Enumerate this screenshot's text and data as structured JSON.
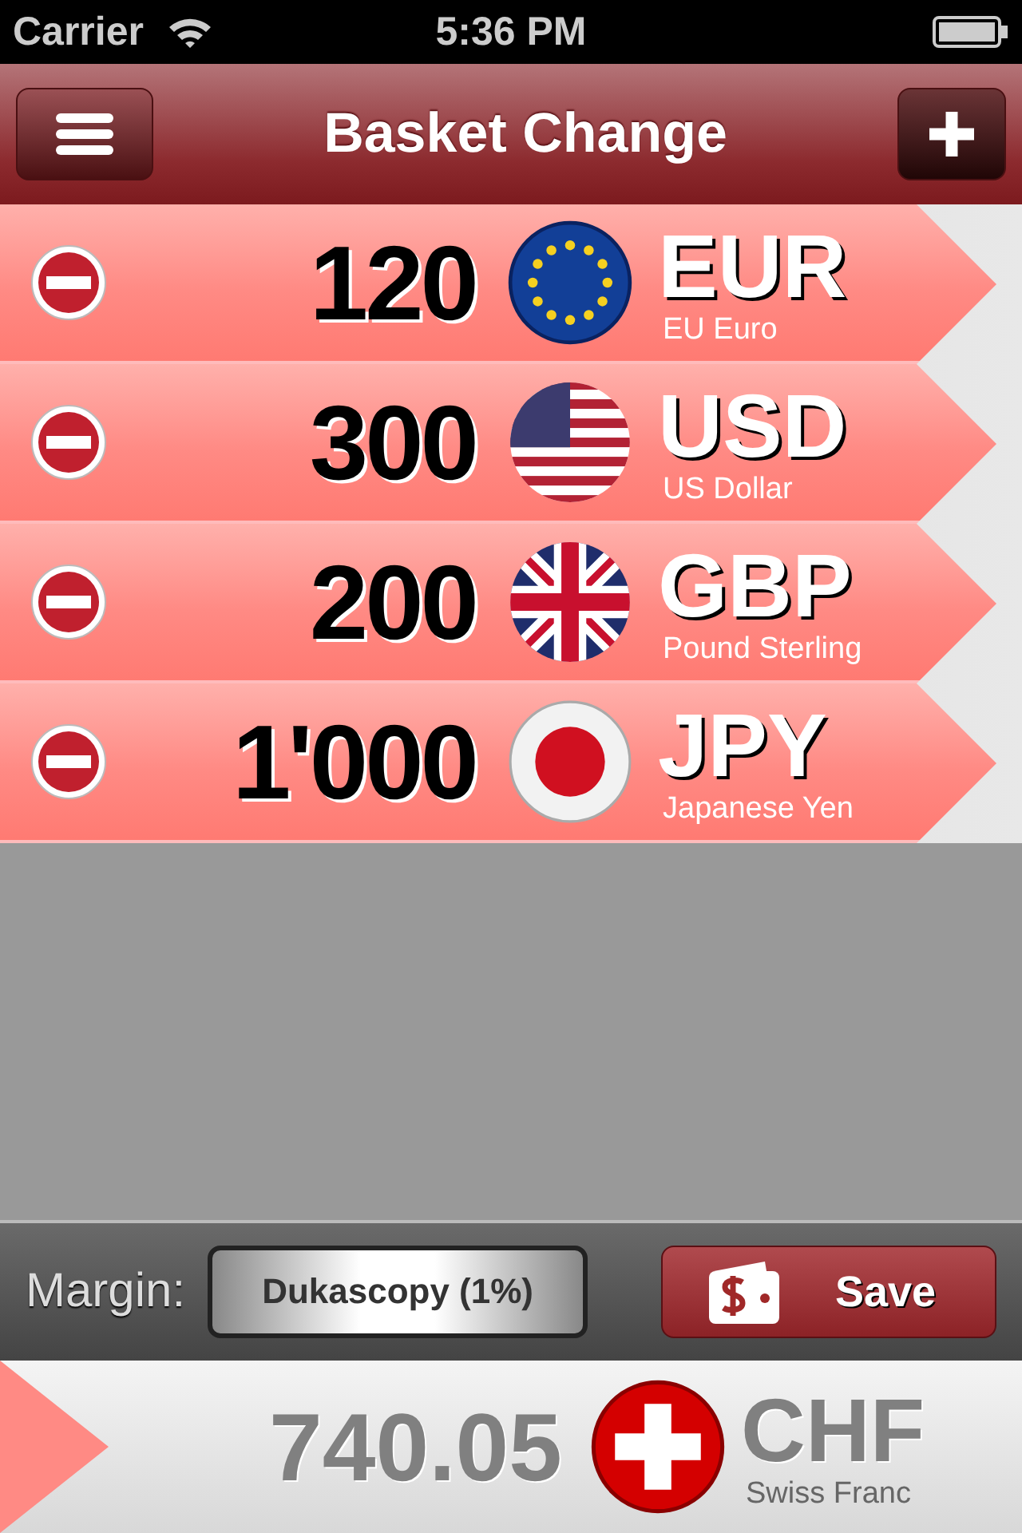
{
  "status_bar": {
    "carrier": "Carrier",
    "time": "5:36 PM"
  },
  "nav_bar": {
    "title": "Basket Change"
  },
  "currencies": [
    {
      "amount": "120",
      "code": "EUR",
      "name": "EU Euro",
      "kind": "eu"
    },
    {
      "amount": "300",
      "code": "USD",
      "name": "US Dollar",
      "kind": "us"
    },
    {
      "amount": "200",
      "code": "GBP",
      "name": "Pound Sterling",
      "kind": "gb"
    },
    {
      "amount": "1'000",
      "code": "JPY",
      "name": "Japanese Yen",
      "kind": "jp"
    }
  ],
  "toolbar": {
    "margin_label": "Margin:",
    "margin_value": "Dukascopy (1%)",
    "save_button": "Save"
  },
  "result": {
    "amount": "740.05",
    "code": "CHF",
    "name": "Swiss Franc",
    "kind": "ch"
  }
}
